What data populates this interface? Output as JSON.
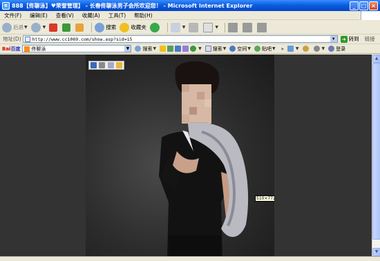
{
  "window": {
    "title": "888【佟聊泳】♥荣誉管理】 - 长春佟聊泳男子会所欢迎您！ - Microsoft Internet Explorer"
  },
  "menu": [
    "文件(F)",
    "编辑(E)",
    "查看(V)",
    "收藏(A)",
    "工具(T)",
    "帮助(H)"
  ],
  "toolbar": {
    "back": "后退",
    "search": "搜索",
    "favorites": "收藏夹"
  },
  "address": {
    "label": "地址(D)",
    "url": "http://www.cc1069.com/show.asp?sid=15",
    "go": "转到",
    "links": "链接"
  },
  "baidu": {
    "logo_red": "Bai",
    "logo_blue": "百度",
    "query": "佟聊泳",
    "search": "搜索",
    "space": "空间",
    "tieba": "贴吧",
    "login": "登录"
  },
  "content": {
    "size_label": "510×772"
  }
}
